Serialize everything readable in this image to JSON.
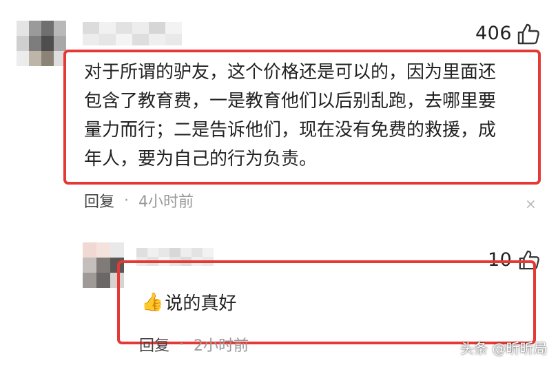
{
  "main_comment": {
    "like_count": "406",
    "text_lines": [
      "对于所谓的驴友，这个价格还是可以的，因为里面还",
      "包含了教育费，一是教育他们以后别乱跑，去哪里要",
      "量力而行；二是告诉他们，现在没有免费的救援，成",
      "年人，要为自己的行为负责。"
    ],
    "reply_label": "回复",
    "separator": "·",
    "time": "4小时前",
    "close_symbol": "×"
  },
  "reply_comment": {
    "like_count": "10",
    "emoji": "👍",
    "text": "说的真好",
    "reply_label": "回复",
    "separator": "·",
    "time": "2小时前"
  },
  "watermark": "头条 @昕昕局",
  "colors": {
    "highlight": "#e53935",
    "text": "#222222",
    "meta": "#999999"
  },
  "icons": {
    "like": "thumbs-up-icon",
    "close": "close-icon",
    "emoji": "thumbs-up-emoji"
  }
}
